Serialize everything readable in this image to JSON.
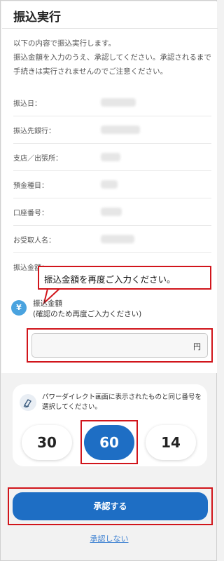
{
  "header": {
    "title": "振込実行"
  },
  "intro": {
    "line1": "以下の内容で振込実行します。",
    "line2": "振込金額を入力のうえ、承認してください。承認されるまで手続きは実行されませんのでご注意ください。"
  },
  "details": {
    "rows": [
      {
        "label": "振込日："
      },
      {
        "label": "振込先銀行："
      },
      {
        "label": "支店／出張所："
      },
      {
        "label": "預金種目："
      },
      {
        "label": "口座番号："
      },
      {
        "label": "お受取人名："
      },
      {
        "label": "振込金額："
      }
    ]
  },
  "callout": {
    "text": "振込金額を再度ご入力ください。"
  },
  "amount": {
    "icon": "yen-icon",
    "icon_glyph": "¥",
    "label_line1": "振込金額",
    "label_line2": "(確認のため再度ご入力ください)",
    "unit": "円",
    "value": ""
  },
  "power_direct": {
    "icon": "edit-hand-icon",
    "instruction": "パワーダイレクト画面に表示されたものと同じ番号を選択してください。",
    "options": [
      "30",
      "60",
      "14"
    ],
    "selected_index": 1
  },
  "actions": {
    "approve_label": "承認する",
    "reject_label": "承認しない"
  },
  "colors": {
    "accent": "#1e6ec4",
    "highlight": "#d1151b",
    "link": "#3a7fd1"
  }
}
